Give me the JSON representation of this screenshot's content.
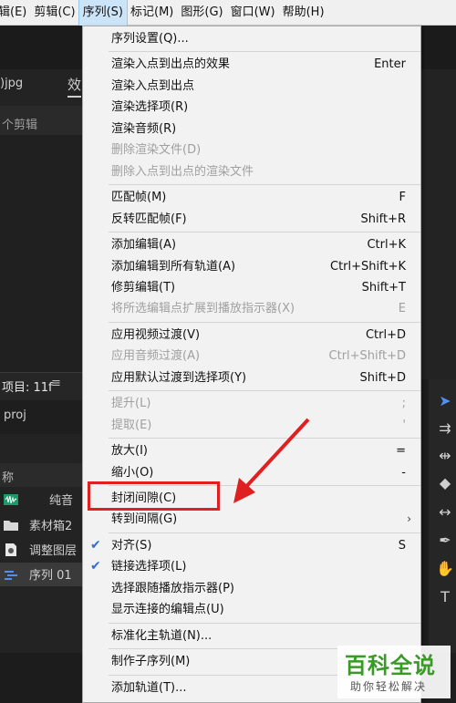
{
  "menubar": {
    "items": [
      {
        "label": "辑(E)",
        "active": false
      },
      {
        "label": "剪辑(C)",
        "active": false
      },
      {
        "label": "序列(S)",
        "active": true
      },
      {
        "label": "标记(M)",
        "active": false
      },
      {
        "label": "图形(G)",
        "active": false
      },
      {
        "label": "窗口(W)",
        "active": false
      },
      {
        "label": "帮助(H)",
        "active": false
      }
    ]
  },
  "left_panel": {
    "file_tab": ")jpg",
    "effects_tab": "效",
    "clip_text": "个剪辑",
    "project_title": "项目: 11f",
    "project_menu": "≡",
    "project_file": "proj",
    "list_header": "称",
    "list_rows": [
      {
        "label": "纯音",
        "icon": "audio-waveform-icon"
      },
      {
        "label": "素材箱2",
        "icon": "folder-icon"
      },
      {
        "label": "调整图层",
        "icon": "adjustment-layer-icon"
      },
      {
        "label": "序列 01",
        "icon": "sequence-icon"
      }
    ]
  },
  "dropdown": {
    "items": [
      {
        "label": "序列设置(Q)...",
        "shortcut": "",
        "disabled": false
      },
      {
        "sep": true
      },
      {
        "label": "渲染入点到出点的效果",
        "shortcut": "Enter",
        "disabled": false
      },
      {
        "label": "渲染入点到出点",
        "shortcut": "",
        "disabled": false
      },
      {
        "label": "渲染选择项(R)",
        "shortcut": "",
        "disabled": false
      },
      {
        "label": "渲染音频(R)",
        "shortcut": "",
        "disabled": false
      },
      {
        "label": "删除渲染文件(D)",
        "shortcut": "",
        "disabled": true
      },
      {
        "label": "删除入点到出点的渲染文件",
        "shortcut": "",
        "disabled": true
      },
      {
        "sep": true
      },
      {
        "label": "匹配帧(M)",
        "shortcut": "F",
        "disabled": false
      },
      {
        "label": "反转匹配帧(F)",
        "shortcut": "Shift+R",
        "disabled": false
      },
      {
        "sep": true
      },
      {
        "label": "添加编辑(A)",
        "shortcut": "Ctrl+K",
        "disabled": false
      },
      {
        "label": "添加编辑到所有轨道(A)",
        "shortcut": "Ctrl+Shift+K",
        "disabled": false
      },
      {
        "label": "修剪编辑(T)",
        "shortcut": "Shift+T",
        "disabled": false
      },
      {
        "label": "将所选编辑点扩展到播放指示器(X)",
        "shortcut": "E",
        "disabled": true
      },
      {
        "sep": true
      },
      {
        "label": "应用视频过渡(V)",
        "shortcut": "Ctrl+D",
        "disabled": false
      },
      {
        "label": "应用音频过渡(A)",
        "shortcut": "Ctrl+Shift+D",
        "disabled": true
      },
      {
        "label": "应用默认过渡到选择项(Y)",
        "shortcut": "Shift+D",
        "disabled": false
      },
      {
        "sep": true
      },
      {
        "label": "提升(L)",
        "shortcut": ";",
        "disabled": true
      },
      {
        "label": "提取(E)",
        "shortcut": "'",
        "disabled": true
      },
      {
        "sep": true
      },
      {
        "label": "放大(I)",
        "shortcut": "=",
        "disabled": false
      },
      {
        "label": "缩小(O)",
        "shortcut": "-",
        "disabled": false
      },
      {
        "sep": true
      },
      {
        "label": "封闭间隙(C)",
        "shortcut": "",
        "disabled": false
      },
      {
        "label": "转到间隔(G)",
        "shortcut": "",
        "disabled": false,
        "submenu": true
      },
      {
        "sep": true
      },
      {
        "label": "对齐(S)",
        "shortcut": "S",
        "disabled": false,
        "checked": true
      },
      {
        "label": "链接选择项(L)",
        "shortcut": "",
        "disabled": false,
        "checked": true
      },
      {
        "label": "选择跟随播放指示器(P)",
        "shortcut": "",
        "disabled": false
      },
      {
        "label": "显示连接的编辑点(U)",
        "shortcut": "",
        "disabled": false
      },
      {
        "sep": true
      },
      {
        "label": "标准化主轨道(N)...",
        "shortcut": "",
        "disabled": false
      },
      {
        "sep": true
      },
      {
        "label": "制作子序列(M)",
        "shortcut": "",
        "disabled": false
      },
      {
        "sep": true
      },
      {
        "label": "添加轨道(T)...",
        "shortcut": "",
        "disabled": false
      }
    ]
  },
  "watermark": {
    "main": "百科全说",
    "sub": "助你轻松解决"
  },
  "colors": {
    "highlight": "#e02020",
    "check": "#2f6fd6",
    "watermark_green": "#3a9a28"
  }
}
